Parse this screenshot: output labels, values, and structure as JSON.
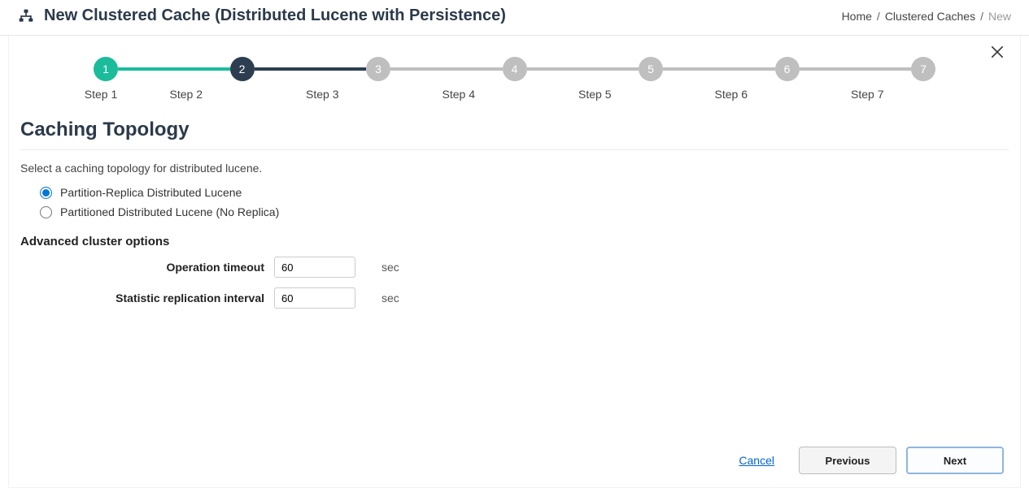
{
  "header": {
    "title": "New Clustered Cache (Distributed Lucene with Persistence)"
  },
  "breadcrumb": {
    "home": "Home",
    "caches": "Clustered Caches",
    "current": "New",
    "sep": "/"
  },
  "stepper": {
    "steps": [
      {
        "num": "1",
        "label": "Step 1",
        "state": "done"
      },
      {
        "num": "2",
        "label": "Step 2",
        "state": "active"
      },
      {
        "num": "3",
        "label": "Step 3",
        "state": "pending"
      },
      {
        "num": "4",
        "label": "Step 4",
        "state": "pending"
      },
      {
        "num": "5",
        "label": "Step 5",
        "state": "pending"
      },
      {
        "num": "6",
        "label": "Step 6",
        "state": "pending"
      },
      {
        "num": "7",
        "label": "Step 7",
        "state": "pending"
      }
    ]
  },
  "section": {
    "title": "Caching Topology",
    "instruction": "Select a caching topology for distributed lucene."
  },
  "topology": {
    "options": [
      {
        "label": "Partition-Replica Distributed Lucene",
        "selected": true
      },
      {
        "label": "Partitioned Distributed Lucene (No Replica)",
        "selected": false
      }
    ]
  },
  "advanced": {
    "title": "Advanced cluster options",
    "operation_timeout": {
      "label": "Operation timeout",
      "value": "60",
      "unit": "sec"
    },
    "stat_interval": {
      "label": "Statistic replication interval",
      "value": "60",
      "unit": "sec"
    }
  },
  "footer": {
    "cancel": "Cancel",
    "previous": "Previous",
    "next": "Next"
  }
}
